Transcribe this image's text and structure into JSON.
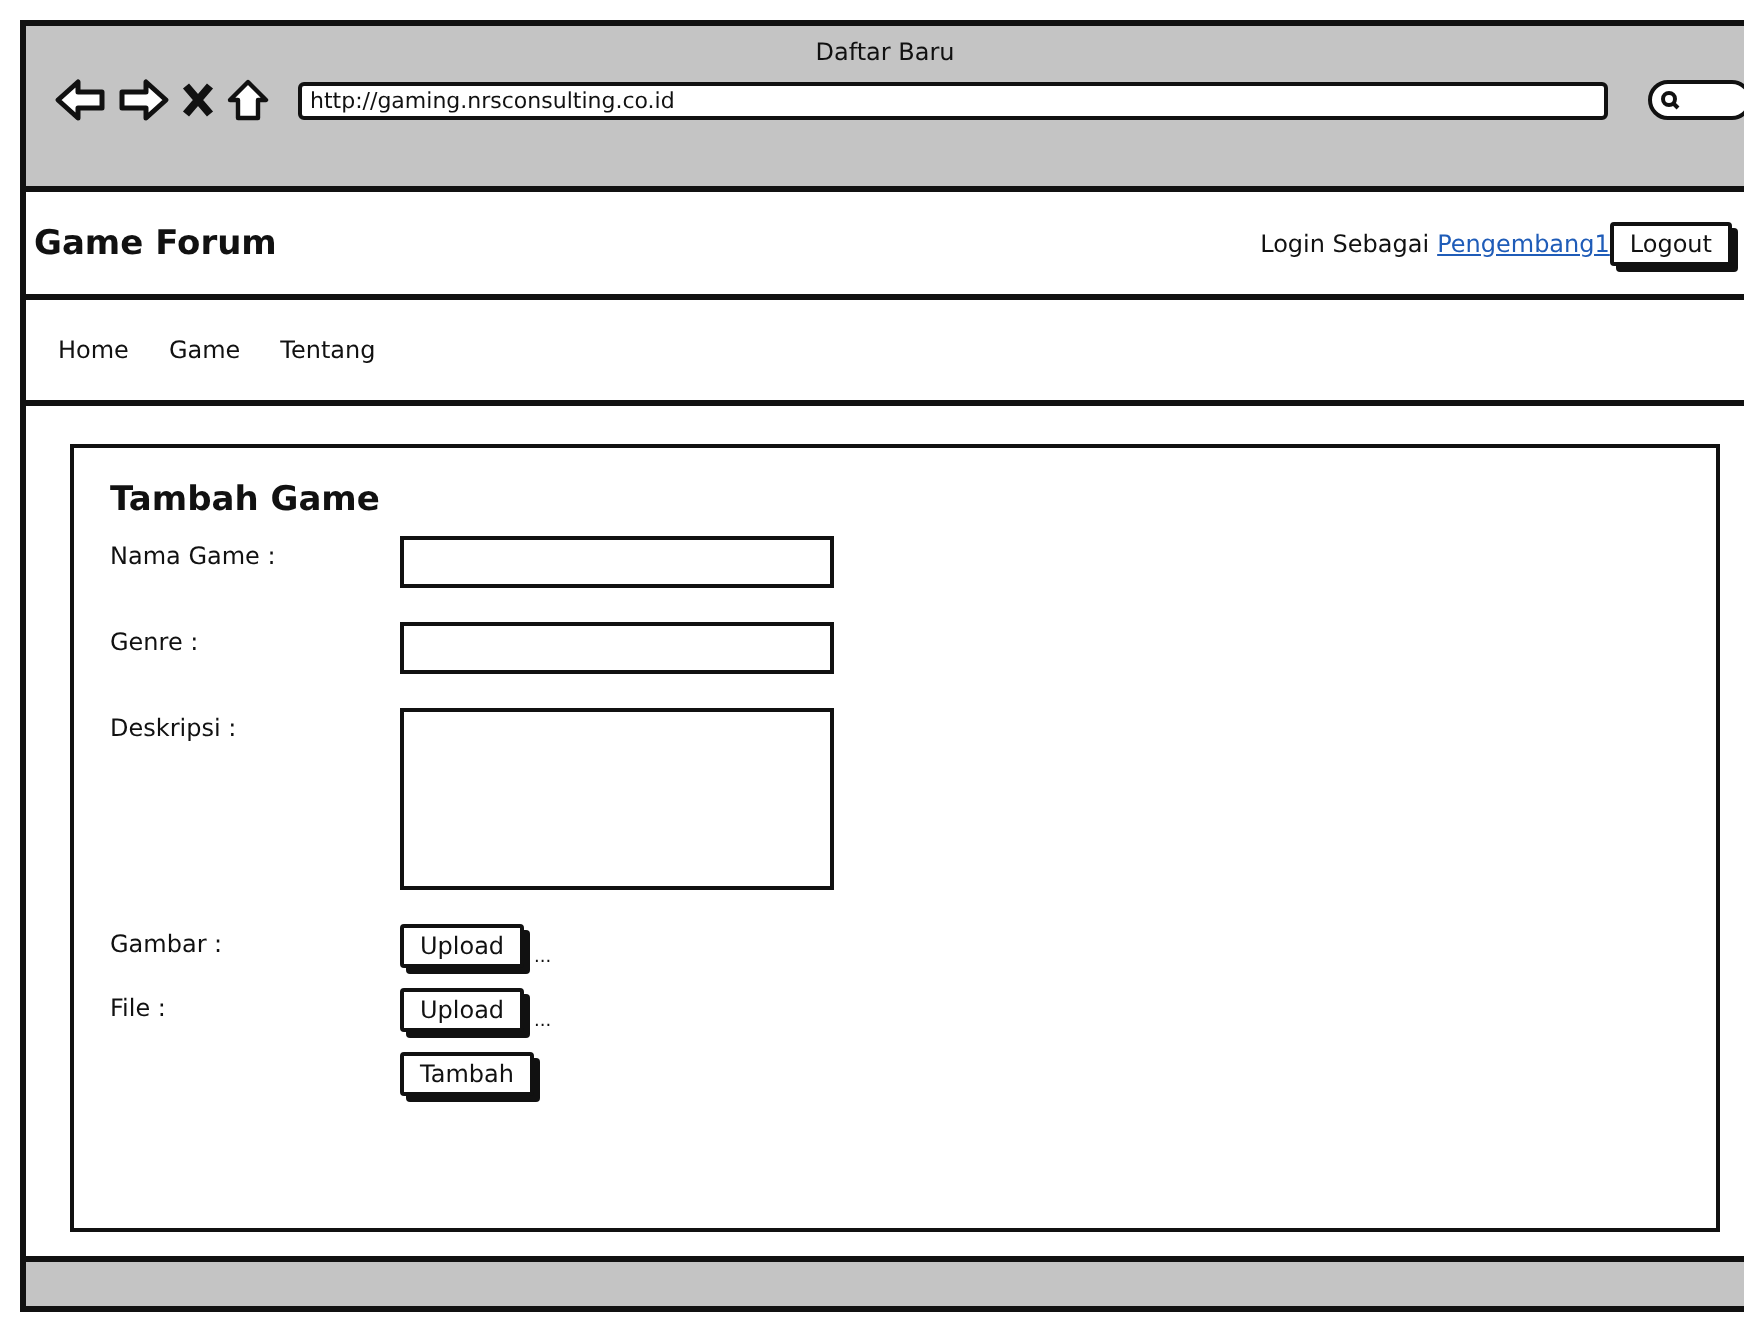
{
  "window": {
    "title": "Daftar Baru",
    "url": "http://gaming.nrsconsulting.co.id"
  },
  "header": {
    "brand": "Game Forum",
    "login_label": "Login Sebagai",
    "user_link": "Pengembang1",
    "logout": "Logout"
  },
  "nav": [
    "Home",
    "Game",
    "Tentang"
  ],
  "form": {
    "title": "Tambah Game",
    "fields": [
      {
        "kind": "text",
        "label": "Nama Game :"
      },
      {
        "kind": "text",
        "label": "Genre :"
      },
      {
        "kind": "textarea",
        "label": "Deskripsi :"
      },
      {
        "kind": "upload",
        "label": "Gambar :",
        "button": "Upload",
        "note": "..."
      },
      {
        "kind": "upload",
        "label": "File :",
        "button": "Upload",
        "note": "..."
      }
    ],
    "submit": "Tambah"
  }
}
